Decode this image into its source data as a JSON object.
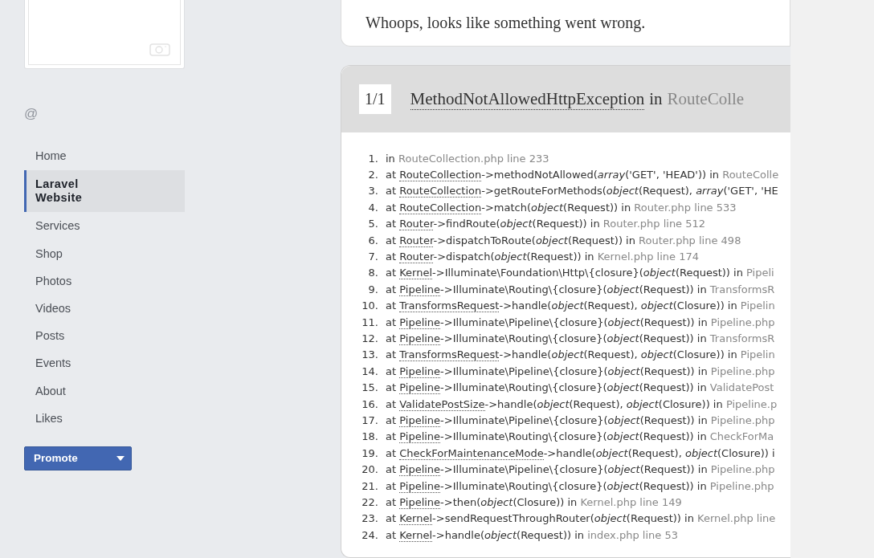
{
  "handle": "@",
  "nav": [
    {
      "label": "Home",
      "selected": false
    },
    {
      "label": "Laravel Website",
      "selected": true
    },
    {
      "label": "Services",
      "selected": false
    },
    {
      "label": "Shop",
      "selected": false
    },
    {
      "label": "Photos",
      "selected": false
    },
    {
      "label": "Videos",
      "selected": false
    },
    {
      "label": "Posts",
      "selected": false
    },
    {
      "label": "Events",
      "selected": false
    },
    {
      "label": "About",
      "selected": false
    },
    {
      "label": "Likes",
      "selected": false
    }
  ],
  "promote_button": {
    "label": "Promote"
  },
  "error": {
    "message": "Whoops, looks like something went wrong.",
    "exception": {
      "counter": "1/1",
      "class": "MethodNotAllowedHttpException",
      "joiner": "in",
      "location": "RouteColle"
    },
    "trace": [
      {
        "number": "1.",
        "prefix": "in",
        "location": "RouteCollection.php line 233"
      },
      {
        "number": "2.",
        "prefix": "at",
        "class": "RouteCollection",
        "call": "->methodNotAllowed(*array*('GET', 'HEAD')) in",
        "location": "RouteColle"
      },
      {
        "number": "3.",
        "prefix": "at",
        "class": "RouteCollection",
        "call": "->getRouteForMethods(*object*(Request), *array*('GET', 'HE"
      },
      {
        "number": "4.",
        "prefix": "at",
        "class": "RouteCollection",
        "call": "->match(*object*(Request)) in",
        "location": "Router.php line 533"
      },
      {
        "number": "5.",
        "prefix": "at",
        "class": "Router",
        "call": "->findRoute(*object*(Request)) in",
        "location": "Router.php line 512"
      },
      {
        "number": "6.",
        "prefix": "at",
        "class": "Router",
        "call": "->dispatchToRoute(*object*(Request)) in",
        "location": "Router.php line 498"
      },
      {
        "number": "7.",
        "prefix": "at",
        "class": "Router",
        "call": "->dispatch(*object*(Request)) in",
        "location": "Kernel.php line 174"
      },
      {
        "number": "8.",
        "prefix": "at",
        "class": "Kernel",
        "call": "->Illuminate\\Foundation\\Http\\{closure}(*object*(Request)) in",
        "location": "Pipeli"
      },
      {
        "number": "9.",
        "prefix": "at",
        "class": "Pipeline",
        "call": "->Illuminate\\Routing\\{closure}(*object*(Request)) in",
        "location": "TransformsR"
      },
      {
        "number": "10.",
        "prefix": "at",
        "class": "TransformsRequest",
        "call": "->handle(*object*(Request), *object*(Closure)) in",
        "location": "Pipelin"
      },
      {
        "number": "11.",
        "prefix": "at",
        "class": "Pipeline",
        "call": "->Illuminate\\Pipeline\\{closure}(*object*(Request)) in",
        "location": "Pipeline.php"
      },
      {
        "number": "12.",
        "prefix": "at",
        "class": "Pipeline",
        "call": "->Illuminate\\Routing\\{closure}(*object*(Request)) in",
        "location": "TransformsR"
      },
      {
        "number": "13.",
        "prefix": "at",
        "class": "TransformsRequest",
        "call": "->handle(*object*(Request), *object*(Closure)) in",
        "location": "Pipelin"
      },
      {
        "number": "14.",
        "prefix": "at",
        "class": "Pipeline",
        "call": "->Illuminate\\Pipeline\\{closure}(*object*(Request)) in",
        "location": "Pipeline.php"
      },
      {
        "number": "15.",
        "prefix": "at",
        "class": "Pipeline",
        "call": "->Illuminate\\Routing\\{closure}(*object*(Request)) in",
        "location": "ValidatePost"
      },
      {
        "number": "16.",
        "prefix": "at",
        "class": "ValidatePostSize",
        "call": "->handle(*object*(Request), *object*(Closure)) in",
        "location": "Pipeline.p"
      },
      {
        "number": "17.",
        "prefix": "at",
        "class": "Pipeline",
        "call": "->Illuminate\\Pipeline\\{closure}(*object*(Request)) in",
        "location": "Pipeline.php"
      },
      {
        "number": "18.",
        "prefix": "at",
        "class": "Pipeline",
        "call": "->Illuminate\\Routing\\{closure}(*object*(Request)) in",
        "location": "CheckForMa"
      },
      {
        "number": "19.",
        "prefix": "at",
        "class": "CheckForMaintenanceMode",
        "call": "->handle(*object*(Request), *object*(Closure)) i"
      },
      {
        "number": "20.",
        "prefix": "at",
        "class": "Pipeline",
        "call": "->Illuminate\\Pipeline\\{closure}(*object*(Request)) in",
        "location": "Pipeline.php"
      },
      {
        "number": "21.",
        "prefix": "at",
        "class": "Pipeline",
        "call": "->Illuminate\\Routing\\{closure}(*object*(Request)) in",
        "location": "Pipeline.php"
      },
      {
        "number": "22.",
        "prefix": "at",
        "class": "Pipeline",
        "call": "->then(*object*(Closure)) in",
        "location": "Kernel.php line 149"
      },
      {
        "number": "23.",
        "prefix": "at",
        "class": "Kernel",
        "call": "->sendRequestThroughRouter(*object*(Request)) in",
        "location": "Kernel.php line"
      },
      {
        "number": "24.",
        "prefix": "at",
        "class": "Kernel",
        "call": "->handle(*object*(Request)) in",
        "location": "index.php line 53"
      }
    ]
  }
}
